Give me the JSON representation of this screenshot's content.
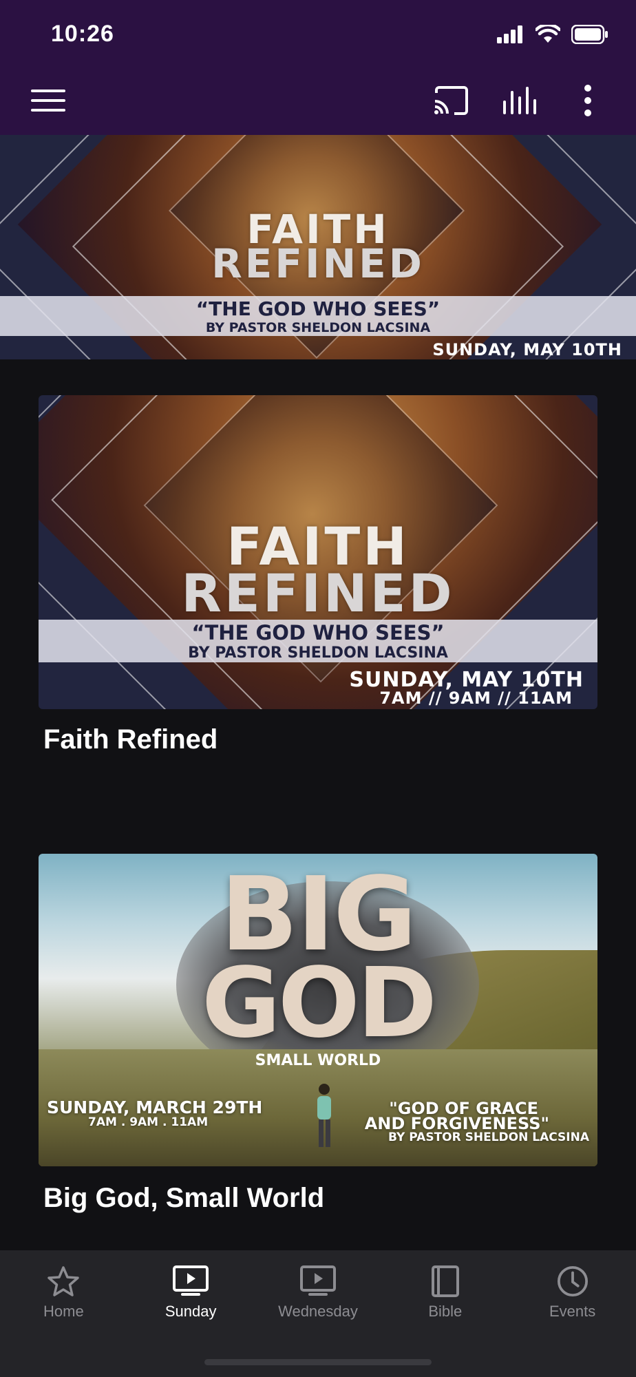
{
  "status_bar": {
    "time": "10:26"
  },
  "colors": {
    "app_bar": "#2b1142",
    "background": "#111114",
    "nav_bar": "#242428",
    "nav_active": "#ffffff",
    "nav_inactive": "#8d8d92"
  },
  "app_bar": {
    "icons": [
      "menu-icon",
      "cast-icon",
      "audio-bars-icon",
      "more-vertical-icon"
    ]
  },
  "hero": {
    "title_line1": "FAITH",
    "title_line2": "REFINED",
    "quote": "“THE GOD WHO SEES”",
    "byline": "BY PASTOR SHELDON LACSINA",
    "date": "SUNDAY, MAY 10TH"
  },
  "sermons": [
    {
      "title": "Faith Refined",
      "art": {
        "title_line1": "FAITH",
        "title_line2": "REFINED",
        "quote": "“THE GOD WHO SEES”",
        "byline": "BY PASTOR SHELDON LACSINA",
        "date": "SUNDAY, MAY 10TH",
        "times": "7AM // 9AM // 11AM"
      }
    },
    {
      "title": "Big God, Small World",
      "art": {
        "title_line1": "BIG",
        "title_line2": "GOD",
        "subtitle": "SMALL WORLD",
        "date": "SUNDAY, MARCH 29TH",
        "times": "7AM . 9AM . 11AM",
        "quote_line1": "\"GOD OF GRACE",
        "quote_line2": "AND FORGIVENESS\"",
        "byline": "BY PASTOR SHELDON LACSINA"
      }
    }
  ],
  "bottom_nav": [
    {
      "label": "Home",
      "icon": "star-icon",
      "active": false
    },
    {
      "label": "Sunday",
      "icon": "play-screen-icon",
      "active": true
    },
    {
      "label": "Wednesday",
      "icon": "play-screen-icon",
      "active": false
    },
    {
      "label": "Bible",
      "icon": "book-icon",
      "active": false
    },
    {
      "label": "Events",
      "icon": "clock-icon",
      "active": false
    }
  ]
}
